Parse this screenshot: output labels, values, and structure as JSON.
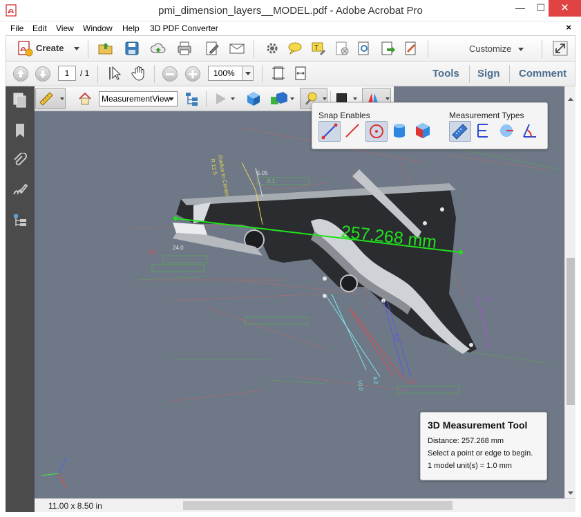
{
  "window": {
    "title": "pmi_dimension_layers__MODEL.pdf - Adobe Acrobat Pro",
    "minimize": "—",
    "maximize": "☐",
    "close": "✕"
  },
  "menu": {
    "items": [
      "File",
      "Edit",
      "View",
      "Window",
      "Help",
      "3D PDF Converter"
    ],
    "doc_close": "×"
  },
  "toolbar": {
    "create_label": "Create",
    "customize_label": "Customize"
  },
  "nav": {
    "page_current": "1",
    "page_total": "/ 1",
    "zoom": "100%",
    "links": [
      "Tools",
      "Sign",
      "Comment"
    ]
  },
  "toolbar3d": {
    "view_selected": "MeasurementView"
  },
  "measure_flyout": {
    "snap_title": "Snap Enables",
    "types_title": "Measurement Types"
  },
  "scene": {
    "measurement_label": "257.268 mm",
    "annotations": [
      "R 12.5",
      "Radius to Center",
      "5.05",
      "0.1",
      "24.0",
      "2X",
      "10.0",
      "4.2",
      "6.2",
      "5.2",
      "1.2"
    ]
  },
  "info_panel": {
    "title": "3D Measurement Tool",
    "distance_label": "Distance:",
    "distance_value": "257.268 mm",
    "instruction": "Select a point or edge to begin.",
    "unit_note": "1 model unit(s) = 1.0 mm"
  },
  "status": {
    "page_size": "11.00 x 8.50 in"
  },
  "colors": {
    "viewport_bg": "#6e7886",
    "measure_line": "#22e01c",
    "nav_pane": "#4b4b4b",
    "panel_links": "#4a6d8c",
    "close_button": "#e04343"
  }
}
